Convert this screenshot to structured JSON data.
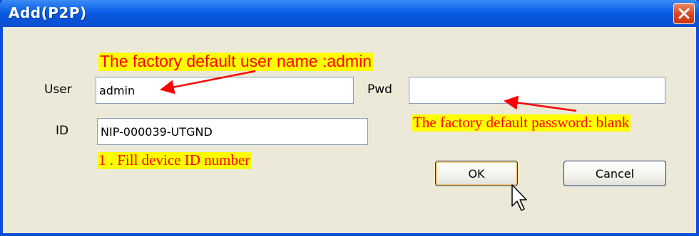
{
  "window": {
    "title": "Add(P2P)"
  },
  "form": {
    "user_label": "User",
    "user_value": "admin",
    "pwd_label": "Pwd",
    "pwd_value": "",
    "id_label": "ID",
    "id_value": "NIP-000039-UTGND"
  },
  "buttons": {
    "ok": "OK",
    "cancel": "Cancel"
  },
  "annotations": {
    "user_note": "The factory default user name :admin",
    "pwd_note": "The factory default password: blank",
    "id_note": "1 . Fill device ID number"
  },
  "colors": {
    "titlebar": "#0a5fe5",
    "dialog_bg": "#ece9d8",
    "annotation_text": "#ff0000",
    "annotation_bg": "#ffff00"
  },
  "icons": [
    "close-icon",
    "arrow-icon",
    "cursor-icon"
  ]
}
